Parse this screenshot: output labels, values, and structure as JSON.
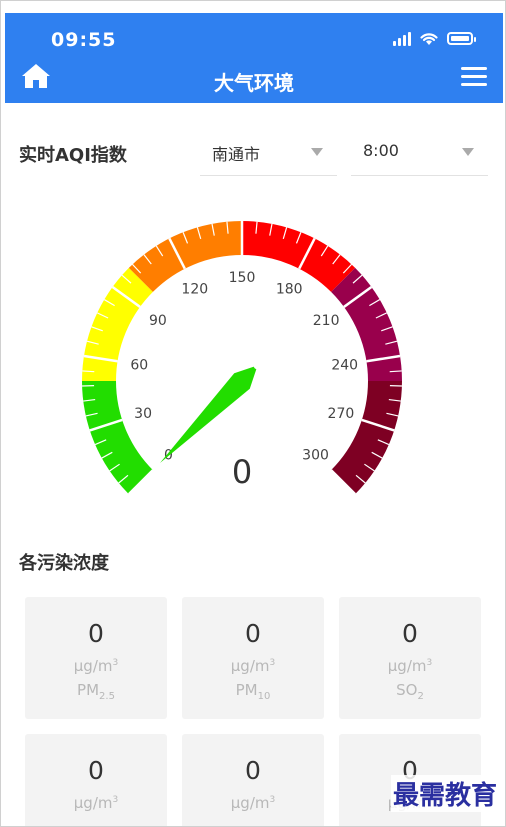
{
  "status": {
    "time": "09:55"
  },
  "nav": {
    "title": "大气环境"
  },
  "aqi": {
    "title": "实时AQI指数",
    "city": "南通市",
    "time": "8:00",
    "value": "0"
  },
  "gauge": {
    "min": 0,
    "max": 300,
    "value": 0,
    "tick_labels": [
      "0",
      "30",
      "60",
      "90",
      "120",
      "150",
      "180",
      "210",
      "240",
      "270",
      "300"
    ],
    "bands": [
      {
        "from": 0,
        "to": 50,
        "color": "#22dd00"
      },
      {
        "from": 50,
        "to": 100,
        "color": "#ffff00"
      },
      {
        "from": 100,
        "to": 150,
        "color": "#ff7e00"
      },
      {
        "from": 150,
        "to": 200,
        "color": "#ff0000"
      },
      {
        "from": 200,
        "to": 250,
        "color": "#99004c"
      },
      {
        "from": 250,
        "to": 300,
        "color": "#7e0023"
      }
    ],
    "needle_color": "#22dd00"
  },
  "pollutants": {
    "title": "各污染浓度",
    "unit": "μg/m",
    "unit_sup": "3",
    "items": [
      {
        "value": "0",
        "name": "PM",
        "sub": "2.5"
      },
      {
        "value": "0",
        "name": "PM",
        "sub": "10"
      },
      {
        "value": "0",
        "name": "SO",
        "sub": "2"
      },
      {
        "value": "0",
        "name": "",
        "sub": ""
      },
      {
        "value": "0",
        "name": "",
        "sub": ""
      },
      {
        "value": "0",
        "name": "",
        "sub": ""
      }
    ]
  },
  "watermark": "最需教育"
}
